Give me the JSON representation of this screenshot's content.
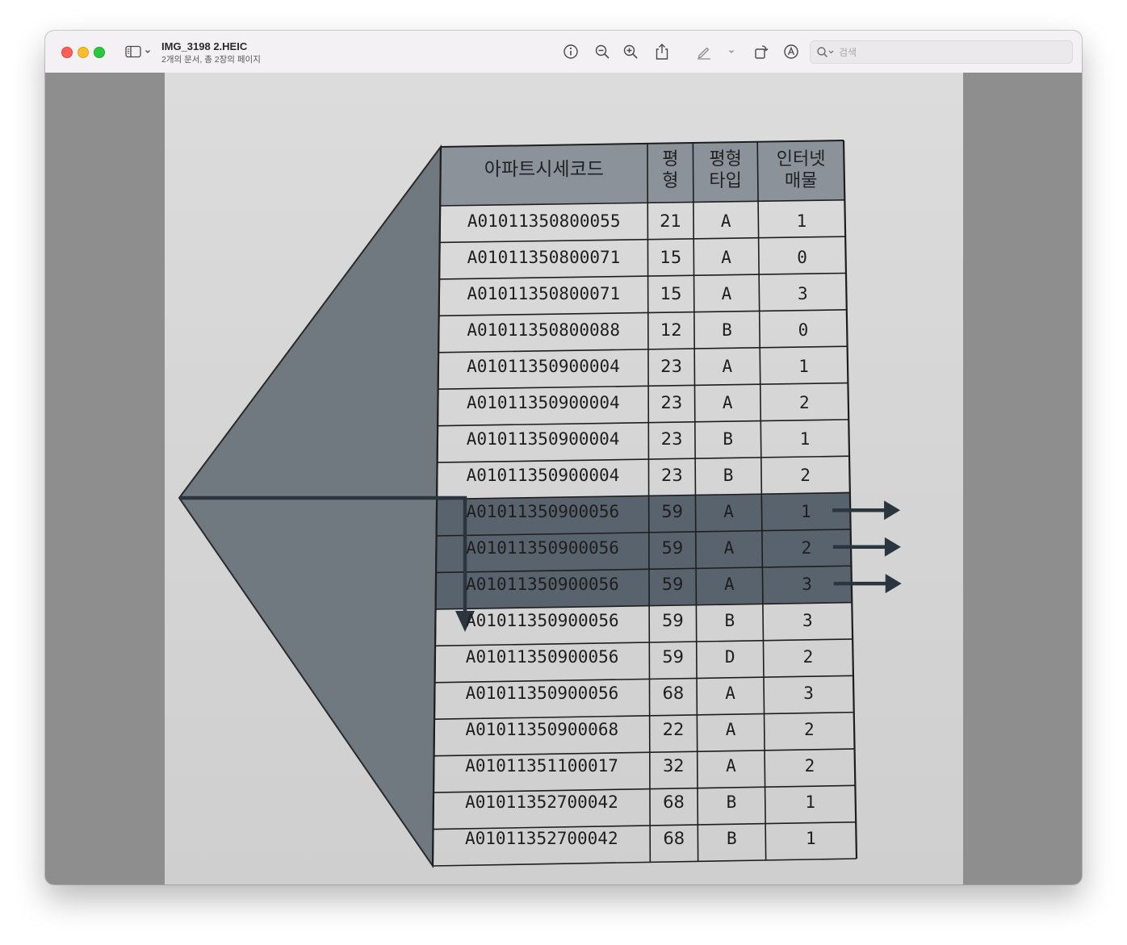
{
  "window": {
    "title": "IMG_3198 2.HEIC",
    "subtitle": "2개의 문서, 총 2장의 페이지"
  },
  "toolbar": {
    "icons": [
      "sidebar-toggle-icon",
      "chevron-down-icon",
      "info-icon",
      "zoom-out-icon",
      "zoom-in-icon",
      "share-icon",
      "markup-pen-icon",
      "chevron-down-icon",
      "rotate-icon",
      "annotate-icon",
      "search-icon"
    ]
  },
  "search": {
    "placeholder": "검색"
  },
  "colors": {
    "accent_band": "#59636d",
    "funnel": "#717980",
    "arrow": "#2b3540"
  },
  "figure": {
    "header": {
      "code": "아파트시세코드",
      "pyeong_1": "평",
      "pyeong_2": "형",
      "type_1": "평형",
      "type_2": "타입",
      "listing_1": "인터넷",
      "listing_2": "매물"
    },
    "rows": [
      {
        "code": "A01011350800055",
        "pyeong": "21",
        "type": "A",
        "listing": "1"
      },
      {
        "code": "A01011350800071",
        "pyeong": "15",
        "type": "A",
        "listing": "0"
      },
      {
        "code": "A01011350800071",
        "pyeong": "15",
        "type": "A",
        "listing": "3"
      },
      {
        "code": "A01011350800088",
        "pyeong": "12",
        "type": "B",
        "listing": "0"
      },
      {
        "code": "A01011350900004",
        "pyeong": "23",
        "type": "A",
        "listing": "1"
      },
      {
        "code": "A01011350900004",
        "pyeong": "23",
        "type": "A",
        "listing": "2"
      },
      {
        "code": "A01011350900004",
        "pyeong": "23",
        "type": "B",
        "listing": "1"
      },
      {
        "code": "A01011350900004",
        "pyeong": "23",
        "type": "B",
        "listing": "2"
      },
      {
        "code": "A01011350900056",
        "pyeong": "59",
        "type": "A",
        "listing": "1",
        "highlighted": true
      },
      {
        "code": "A01011350900056",
        "pyeong": "59",
        "type": "A",
        "listing": "2",
        "highlighted": true
      },
      {
        "code": "A01011350900056",
        "pyeong": "59",
        "type": "A",
        "listing": "3",
        "highlighted": true
      },
      {
        "code": "A01011350900056",
        "pyeong": "59",
        "type": "B",
        "listing": "3"
      },
      {
        "code": "A01011350900056",
        "pyeong": "59",
        "type": "D",
        "listing": "2"
      },
      {
        "code": "A01011350900056",
        "pyeong": "68",
        "type": "A",
        "listing": "3"
      },
      {
        "code": "A01011350900068",
        "pyeong": "22",
        "type": "A",
        "listing": "2"
      },
      {
        "code": "A01011351100017",
        "pyeong": "32",
        "type": "A",
        "listing": "2"
      },
      {
        "code": "A01011352700042",
        "pyeong": "68",
        "type": "B",
        "listing": "1"
      },
      {
        "code": "A01011352700042",
        "pyeong": "68",
        "type": "B",
        "listing": "1"
      }
    ]
  }
}
